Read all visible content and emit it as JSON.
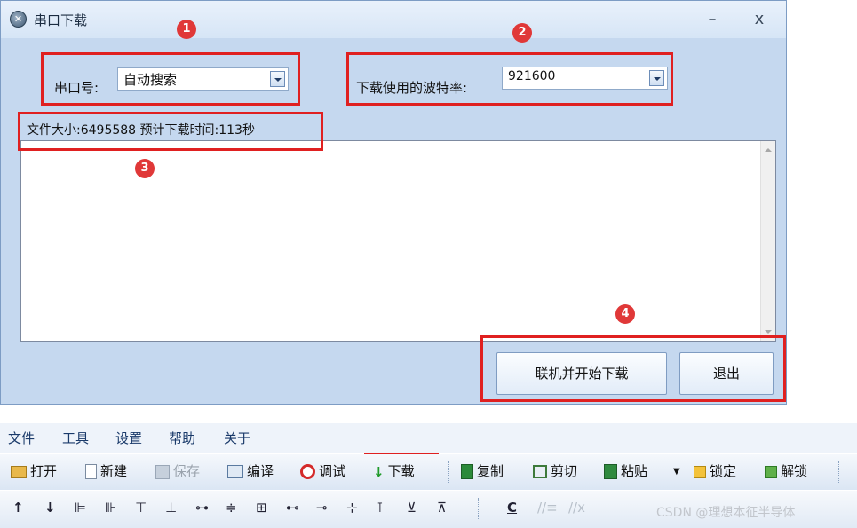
{
  "window": {
    "title": "串口下载",
    "minimize": "–",
    "close": "x"
  },
  "port": {
    "label": "串口号:",
    "value": "自动搜索"
  },
  "baud": {
    "label": "下载使用的波特率:",
    "value": "921600"
  },
  "info": {
    "text": "文件大小:6495588 预计下载时间:113秒"
  },
  "buttons": {
    "start": "联机并开始下载",
    "exit": "退出"
  },
  "badges": [
    "1",
    "2",
    "3",
    "4"
  ],
  "menu": [
    "文件",
    "工具",
    "设置",
    "帮助",
    "关于"
  ],
  "toolbar": {
    "open": "打开",
    "new": "新建",
    "save": "保存",
    "compile": "编译",
    "debug": "调试",
    "download": "下载",
    "copy": "复制",
    "cut": "剪切",
    "paste": "粘贴",
    "lock": "锁定",
    "unlock": "解锁"
  },
  "toolbar2": {
    "glyphs": [
      "↑",
      "↓",
      "⊫",
      "⊪",
      "⊤",
      "⊥",
      "⊶",
      "≑",
      "⊞",
      "⊷",
      "⊸",
      "⊹",
      "⊺",
      "⊻",
      "⊼"
    ],
    "c_label": "C"
  },
  "watermark": "CSDN @理想本征半导体",
  "colors": {
    "highlight": "#e02020",
    "badge": "#e03838",
    "dialog_bg": "#c5d8ef"
  }
}
